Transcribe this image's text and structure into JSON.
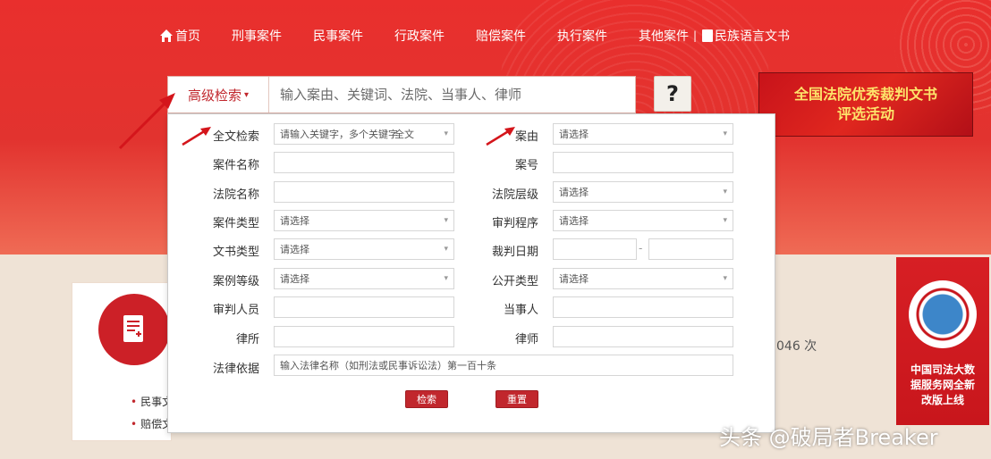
{
  "nav": {
    "home": "首页",
    "criminal": "刑事案件",
    "civil": "民事案件",
    "administrative": "行政案件",
    "compensation": "赔偿案件",
    "execution": "执行案件",
    "other": "其他案件",
    "separator": "|",
    "minority_docs": "民族语言文书"
  },
  "search": {
    "advanced_label": "高级检索",
    "caret": "▾",
    "placeholder": "输入案由、关键词、法院、当事人、律师",
    "help": "?"
  },
  "banners": {
    "award": "全国法院优秀裁判文书\n评选活动",
    "bigdata": "中国司法大数\n据服务网全新\n改版上线"
  },
  "panel": {
    "fulltext_label": "全文检索",
    "fulltext_value": "请输入关键字，多个关键字",
    "fulltext_scope": "全文",
    "cause_label": "案由",
    "cause_value": "请选择",
    "case_name_label": "案件名称",
    "case_no_label": "案号",
    "court_name_label": "法院名称",
    "court_level_label": "法院层级",
    "court_level_value": "请选择",
    "case_type_label": "案件类型",
    "case_type_value": "请选择",
    "procedure_label": "审判程序",
    "procedure_value": "请选择",
    "doc_type_label": "文书类型",
    "doc_type_value": "请选择",
    "judge_date_label": "裁判日期",
    "date_separator": "-",
    "case_year_label": "案例等级",
    "case_year_value": "请选择",
    "disclosure_label": "公开类型",
    "disclosure_value": "请选择",
    "judge_label": "审判人员",
    "party_label": "当事人",
    "lawyer_label": "律所",
    "law_firm_label": "律师",
    "legal_basis_label": "法律依据",
    "legal_basis_placeholder": "输入法律名称（如刑法或民事诉讼法）第一百十条",
    "search_btn": "检索",
    "reset_btn": "重置"
  },
  "lower": {
    "civil_docs": "民事文",
    "compensation_docs": "赔偿文",
    "visit_count": "046 次"
  },
  "watermark": "头条 @破局者Breaker",
  "colors": {
    "brand_red": "#e2332f",
    "button_red": "#c1272d",
    "award_text": "#fde36a"
  }
}
